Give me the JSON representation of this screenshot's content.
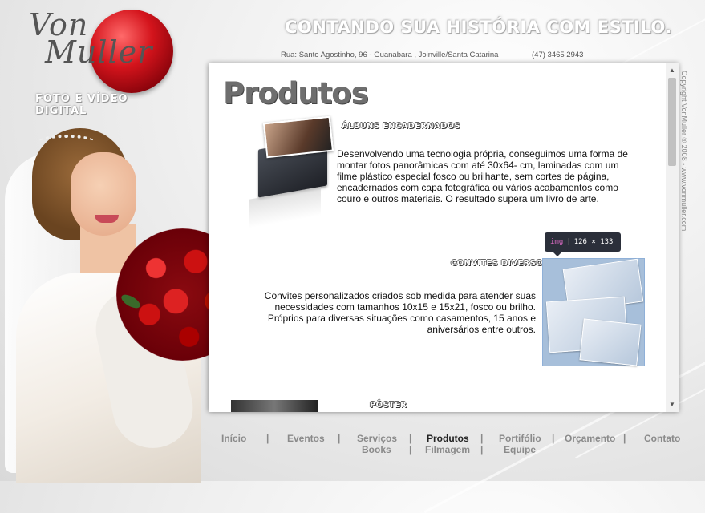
{
  "logo": {
    "script_line1": "Von",
    "script_line2": "Muller",
    "subtitle": "FOTO E VÍDEO DIGITAL"
  },
  "header": {
    "tagline": "CONTANDO SUA HISTÓRIA COM ESTILO.",
    "address": "Rua: Santo Agostinho, 96 - Guanabara , Joinville/Santa Catarina",
    "phone": "(47) 3465 2943",
    "copyright": "Copyright VonMuller ® 2008 - www.vonmuller.com"
  },
  "content": {
    "title": "Produtos",
    "sections": [
      {
        "heading": "ÁLBUNS ENCADERNADOS",
        "text": "Desenvolvendo uma tecnologia própria, conseguimos uma forma de montar fotos panorâmicas com até 30x64- cm, laminadas com um filme plástico especial fosco ou brilhante, sem cortes de página, encadernados com capa fotográfica ou vários acabamentos como couro e outros materiais. O resultado supera um livro de arte."
      },
      {
        "heading": "CONVITES DIVERSOS",
        "text": "Convites personalizados criados sob medida para atender suas necessidades com tamanhos 10x15 e 15x21, fosco ou brilho. Próprios para diversas situações como casamentos, 15 anos e aniversários entre outros."
      },
      {
        "heading": "PÔSTER",
        "text": ""
      }
    ],
    "tooltip": {
      "tag": "img",
      "size": "126 × 133"
    }
  },
  "nav": {
    "row1": [
      "Início",
      "Eventos",
      "Serviços",
      "Produtos",
      "Portifólio",
      "Orçamento",
      "Contato"
    ],
    "row2": [
      "Books",
      "Filmagem",
      "Equipe"
    ],
    "separator": "|",
    "active": "Produtos"
  }
}
